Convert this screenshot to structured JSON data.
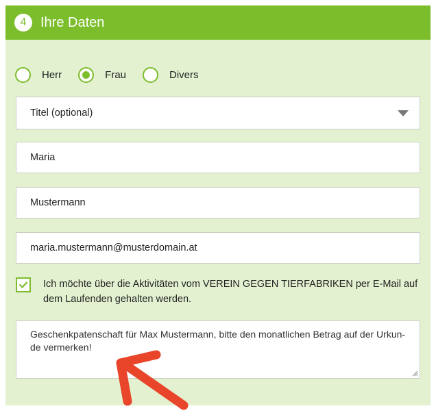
{
  "section": {
    "step_number": "4",
    "title": "Ihre Daten"
  },
  "salutation": {
    "options": [
      {
        "label": "Herr",
        "selected": false
      },
      {
        "label": "Frau",
        "selected": true
      },
      {
        "label": "Divers",
        "selected": false
      }
    ]
  },
  "title_select": {
    "value": "Titel (optional)"
  },
  "first_name": {
    "value": "Maria"
  },
  "last_name": {
    "value": "Mustermann"
  },
  "email": {
    "value": "maria.mustermann@musterdomain.at"
  },
  "newsletter": {
    "checked": true,
    "label": "Ich möchte über die Aktivitäten vom VEREIN GEGEN TIERFABRIKEN per E-Mail auf dem Laufenden gehalten werden."
  },
  "message": {
    "value": "Geschenkpatenschaft für Max Mustermann, bitte den monatlichen Betrag auf der Urkun-de vermerken!"
  },
  "colors": {
    "accent": "#7cbd2b",
    "panel_background": "#e3f1d0",
    "annotation_arrow": "#e8452b"
  },
  "icons": {
    "dropdown": "chevron-down-icon",
    "checkbox": "checkmark-icon",
    "annotation": "arrow-icon",
    "resize": "resize-grip-icon"
  }
}
